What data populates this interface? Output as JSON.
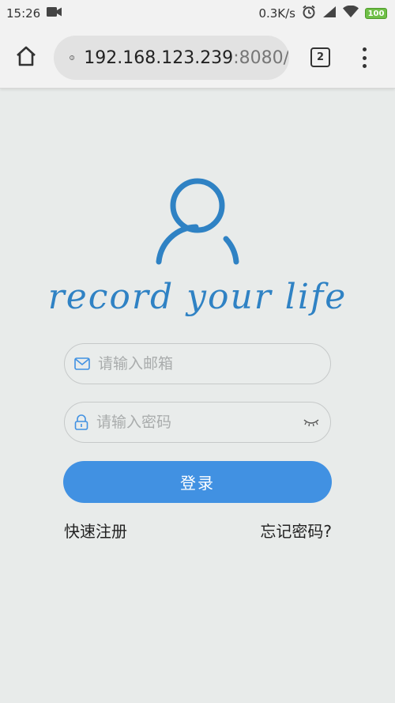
{
  "status_bar": {
    "time": "15:26",
    "network_speed": "0.3K/s",
    "battery": "100"
  },
  "browser": {
    "url_host": "192.168.123.239",
    "url_port": ":8080/",
    "tab_count": "2"
  },
  "page": {
    "slogan": "record your life",
    "email_placeholder": "请输入邮箱",
    "password_placeholder": "请输入密码",
    "login_label": "登录",
    "register_label": "快速注册",
    "forgot_label": "忘记密码?"
  },
  "icons": {
    "status_left": [
      "video-camera-icon"
    ],
    "status_right": [
      "alarm-icon",
      "signal-icon",
      "wifi-icon",
      "battery-icon"
    ],
    "toolbar": [
      "home-icon",
      "info-icon",
      "tabs-icon",
      "more-vert-icon"
    ],
    "fields": [
      "mail-icon",
      "lock-icon",
      "eye-closed-icon"
    ]
  },
  "colors": {
    "accent": "#4191e2",
    "logo_blue": "#2f82c4",
    "background": "#e8ebea"
  }
}
